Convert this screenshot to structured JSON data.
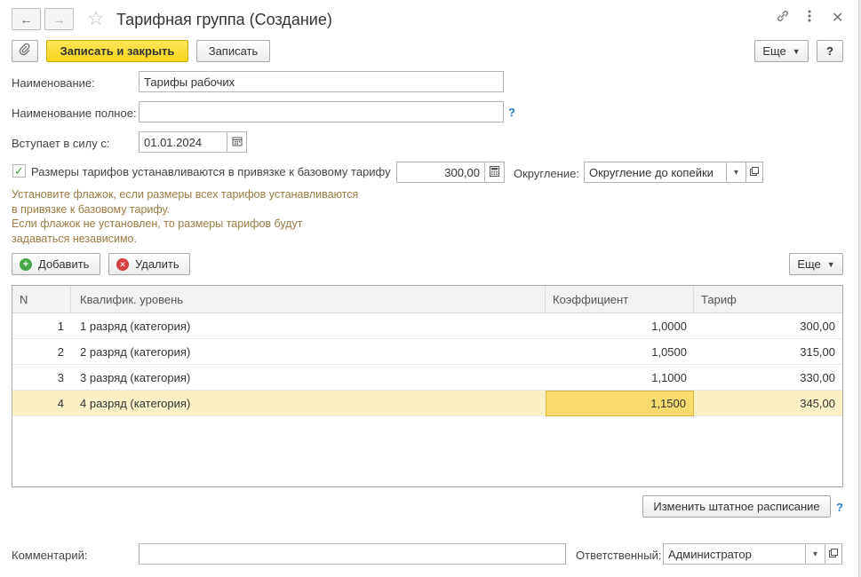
{
  "window": {
    "title": "Тарифная группа (Создание)",
    "back_icon": "arrow-left-icon",
    "forward_icon": "arrow-right-icon",
    "favorite_icon": "star-icon",
    "link_icon": "link-icon",
    "menu_icon": "more-vertical-icon",
    "close_icon": "close-icon"
  },
  "toolbar": {
    "attach_icon": "paperclip-icon",
    "save_close_label": "Записать и закрыть",
    "save_label": "Записать",
    "more_label": "Еще",
    "help_label": "?"
  },
  "form": {
    "name_label": "Наименование:",
    "name_value": "Тарифы рабочих",
    "full_name_label": "Наименование полное:",
    "full_name_value": "",
    "effective_label": "Вступает в силу с:",
    "effective_value": "01.01.2024",
    "base_tariff_checkbox_label": "Размеры тарифов устанавливаются в привязке к базовому тарифу",
    "base_tariff_checked": true,
    "base_tariff_value": "300,00",
    "rounding_label": "Округление:",
    "rounding_value": "Округление до копейки",
    "hint_lines": [
      "Установите флажок, если размеры всех тарифов устанавливаются",
      "в привязке к базовому тарифу.",
      "Если флажок не установлен, то размеры тарифов будут",
      "задаваться независимо."
    ]
  },
  "table_toolbar": {
    "add_label": "Добавить",
    "delete_label": "Удалить",
    "more_label": "Еще"
  },
  "table": {
    "columns": [
      "N",
      "Квалифик. уровень",
      "Коэффициент",
      "Тариф"
    ],
    "rows": [
      {
        "n": "1",
        "level": "1 разряд (категория)",
        "coef": "1,0000",
        "tariff": "300,00"
      },
      {
        "n": "2",
        "level": "2 разряд (категория)",
        "coef": "1,0500",
        "tariff": "315,00"
      },
      {
        "n": "3",
        "level": "3 разряд (категория)",
        "coef": "1,1000",
        "tariff": "330,00"
      },
      {
        "n": "4",
        "level": "4 разряд (категория)",
        "coef": "1,1500",
        "tariff": "345,00"
      }
    ],
    "selected_row": 4
  },
  "footer": {
    "change_schedule_label": "Изменить штатное расписание",
    "help_label": "?",
    "comment_label": "Комментарий:",
    "comment_value": "",
    "responsible_label": "Ответственный:",
    "responsible_value": "Администратор"
  },
  "colors": {
    "primary_button": "#f7d31b",
    "selected_row": "#fbf1c4",
    "active_cell": "#f9da6f",
    "hint_text": "#9c7a43",
    "help_link": "#2a7ccf"
  }
}
